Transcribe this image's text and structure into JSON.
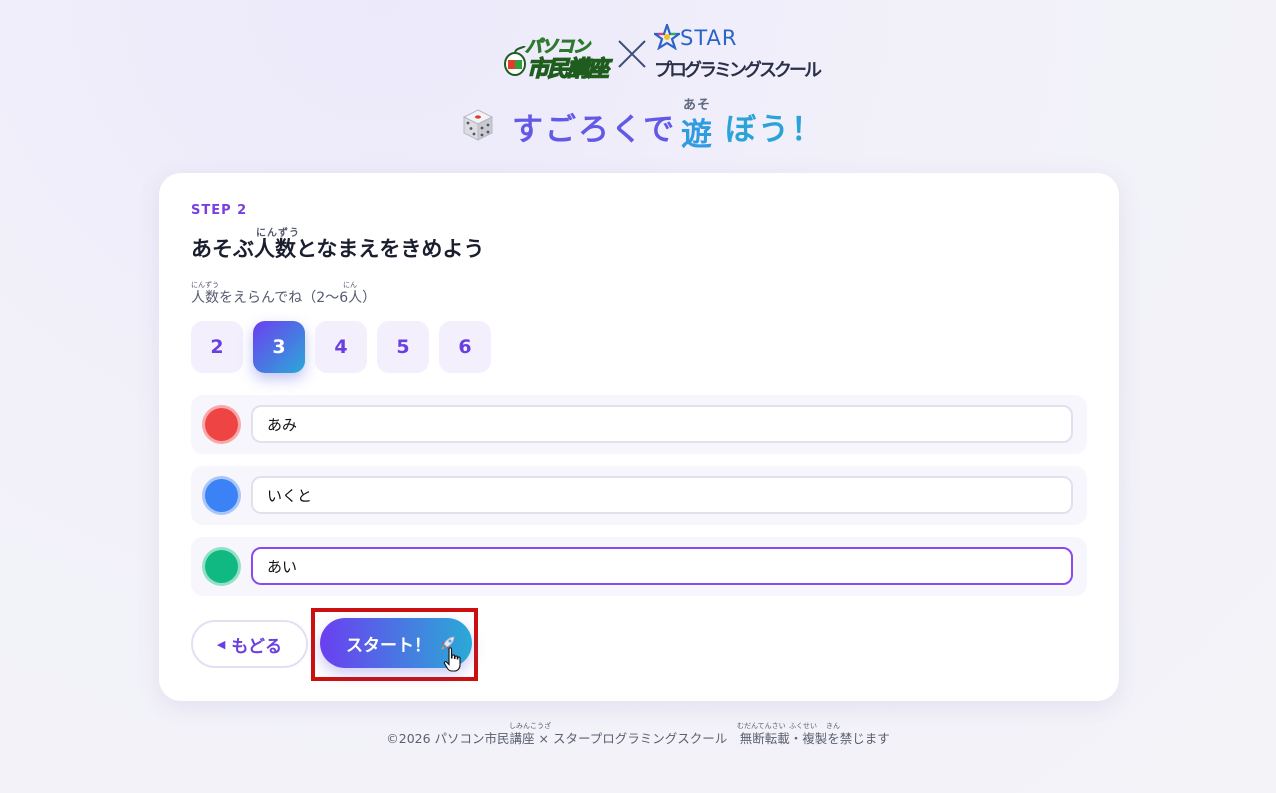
{
  "header": {
    "logo_pc_top": "パソコン",
    "logo_pc_bottom": "市民講座",
    "logo_star_word": "STAR",
    "logo_star_sub": "プログラミングスクール",
    "title_part1": "すごろくで",
    "title_kanji": "遊",
    "title_kanji_ruby": "あそ",
    "title_part2": "ぼう！"
  },
  "card": {
    "step_label": "STEP 2",
    "heading": "あそぶ人数となまえをきめよう",
    "heading_ruby": "にんずう",
    "subtext": "人数をえらんでね（2〜6人）",
    "subtext_ruby_1": "にんずう",
    "subtext_ruby_2": "にん",
    "player_counts": [
      {
        "label": "2",
        "selected": false
      },
      {
        "label": "3",
        "selected": true
      },
      {
        "label": "4",
        "selected": false
      },
      {
        "label": "5",
        "selected": false
      },
      {
        "label": "6",
        "selected": false
      }
    ],
    "players": [
      {
        "color": "#ef4444",
        "ring": "#f7a9a9",
        "name": "あみ",
        "focused": false
      },
      {
        "color": "#3b82f6",
        "ring": "#a8c6f8",
        "name": "いくと",
        "focused": false
      },
      {
        "color": "#10b981",
        "ring": "#93e0c4",
        "name": "あい",
        "focused": true
      }
    ],
    "back_label": "もどる",
    "back_icon": "triangle-left-icon",
    "start_label": "スタート！",
    "start_icon": "rocket-icon"
  },
  "footer": {
    "text": "©2026 パソコン市民講座 × スタープログラミングスクール　無断転載・複製を禁じます",
    "ruby_shimin": "しみんこうざ",
    "ruby_mudan": "むだんてんさい",
    "ruby_fukusei": "ふくせい",
    "ruby_kin": "きん"
  },
  "colors": {
    "accent_purple": "#6b3ff0",
    "accent_cyan": "#2aaad6",
    "highlight_red": "#cc1010"
  }
}
